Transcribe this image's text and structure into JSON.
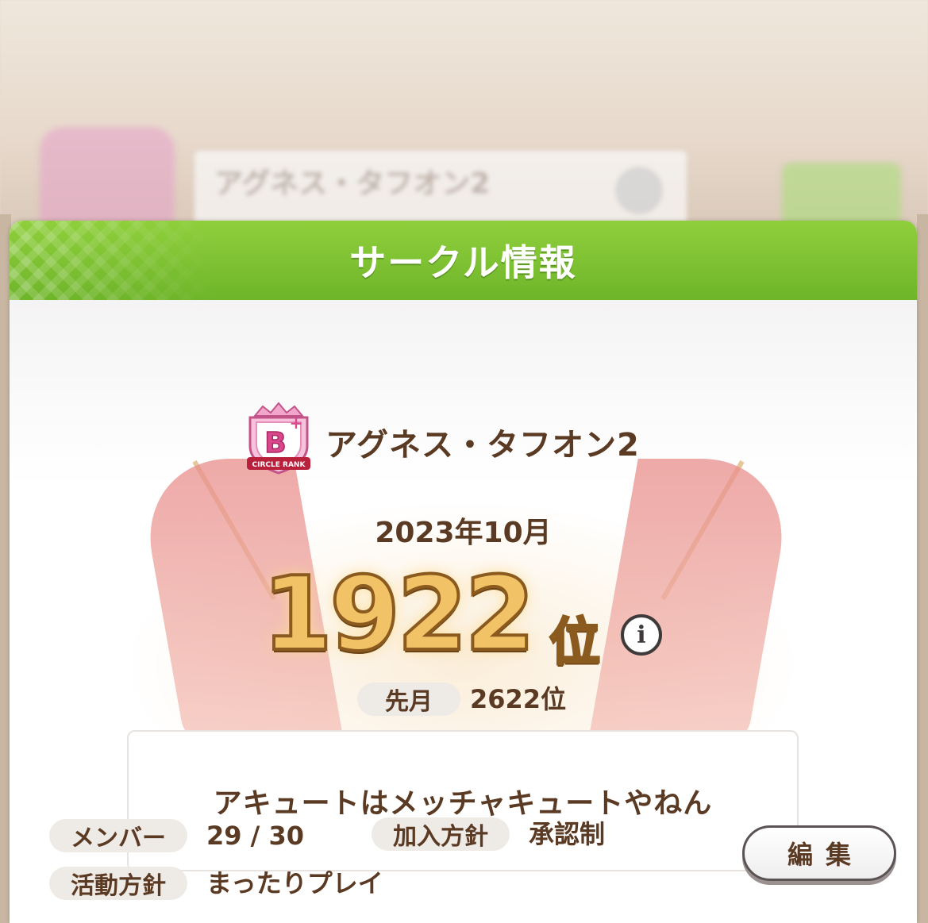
{
  "background": {
    "circle_name": "アグネス・タフオン2"
  },
  "dialog": {
    "title": "サークル情報",
    "rank_badge_text": "B",
    "rank_badge_plus": "+",
    "rank_badge_caption": "CIRCLE RANK",
    "circle_name": "アグネス・タフオン2",
    "month": "2023年10月",
    "rank_number": "1922",
    "rank_unit": "位",
    "info_icon": "i",
    "last_month_label": "先月",
    "last_month_value": "2622位",
    "comment": "アキュートはメッチャキュートやねん",
    "members_label": "メンバー",
    "members_value": "29 / 30",
    "join_policy_label": "加入方針",
    "join_policy_value": "承認制",
    "activity_policy_label": "活動方針",
    "activity_policy_value": "まったりプレイ",
    "edit_button": "編集"
  },
  "colors": {
    "header_green": "#7fc234",
    "text_brown": "#5b3a24",
    "rank_gold": "#f2c266"
  }
}
